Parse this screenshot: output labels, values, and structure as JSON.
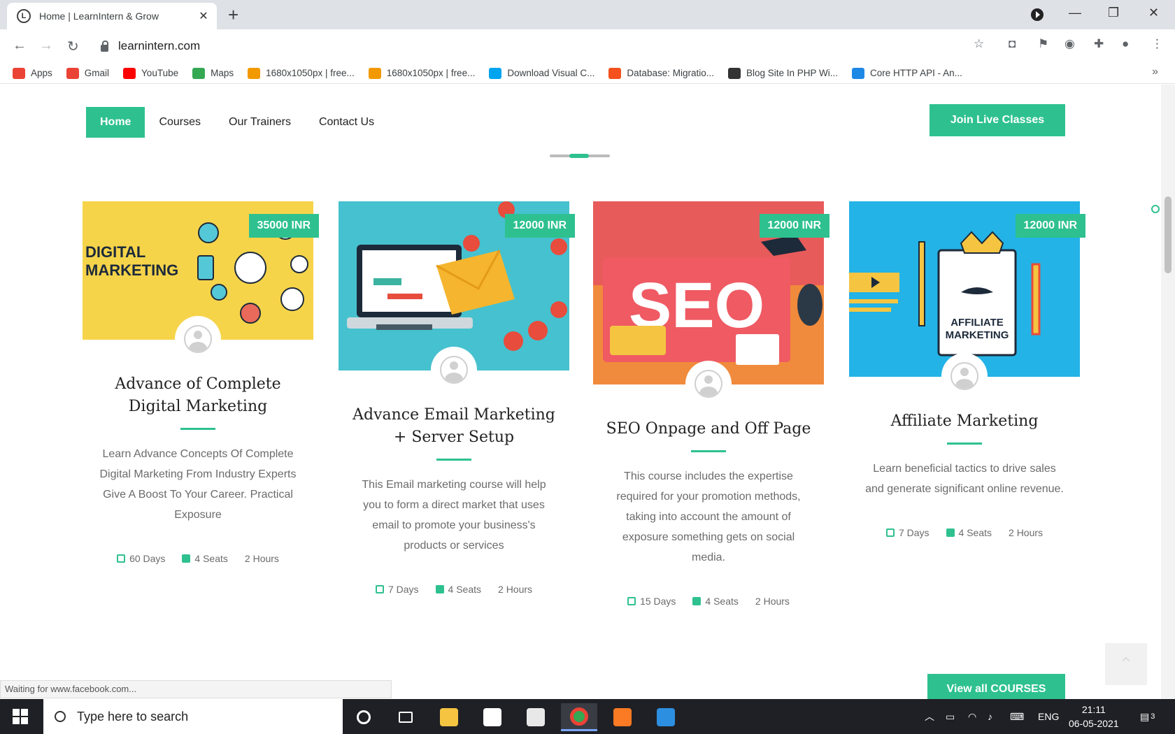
{
  "browser": {
    "tab_title": "Home | LearnIntern & Grow",
    "favicon_letter": "L",
    "url": "learnintern.com",
    "status_text": "Waiting for www.facebook.com..."
  },
  "bookmarks": [
    {
      "label": "Apps",
      "color": "#ea4335"
    },
    {
      "label": "Gmail",
      "color": "#ea4335"
    },
    {
      "label": "YouTube",
      "color": "#ff0000"
    },
    {
      "label": "Maps",
      "color": "#34a853"
    },
    {
      "label": "1680x1050px | free...",
      "color": "#f29900"
    },
    {
      "label": "1680x1050px | free...",
      "color": "#f29900"
    },
    {
      "label": "Download Visual C...",
      "color": "#00a4ef"
    },
    {
      "label": "Database: Migratio...",
      "color": "#f4511e"
    },
    {
      "label": "Blog Site In PHP Wi...",
      "color": "#333333"
    },
    {
      "label": "Core HTTP API - An...",
      "color": "#1e88e5"
    }
  ],
  "nav": {
    "items": [
      "Home",
      "Courses",
      "Our Trainers",
      "Contact Us"
    ],
    "join_label": "Join Live Classes"
  },
  "courses": [
    {
      "price": "35000 INR",
      "title": "Advance of Complete Digital Marketing",
      "desc": "Learn Advance Concepts Of Complete Digital Marketing From Industry Experts Give A Boost To Your Career. Practical Exposure",
      "days": "60 Days",
      "seats": "4 Seats",
      "hours": "2 Hours",
      "image_text": [
        "DIGITAL",
        "MARKETING"
      ],
      "image_bg": "#f6d44a"
    },
    {
      "price": "12000 INR",
      "title": "Advance Email Marketing + Server Setup",
      "desc": "This Email marketing course will help you to form a direct market that uses email to promote your business's products or services",
      "days": "7 Days",
      "seats": "4 Seats",
      "hours": "2 Hours",
      "image_bg": "#46c1cf"
    },
    {
      "price": "12000 INR",
      "title": "SEO Onpage and Off Page",
      "desc": "This course includes the expertise required for your promotion methods, taking into account the amount of exposure something gets on social media.",
      "days": "15 Days",
      "seats": "4 Seats",
      "hours": "2 Hours",
      "image_text": [
        "SEO"
      ],
      "image_bg": "#f08a3c"
    },
    {
      "price": "12000 INR",
      "title": "Affiliate Marketing",
      "desc": "Learn beneficial tactics to drive sales and generate significant online revenue.",
      "days": "7 Days",
      "seats": "4 Seats",
      "hours": "2 Hours",
      "image_text": [
        "AFFILIATE",
        "MARKETING"
      ],
      "image_bg": "#23b3e6"
    }
  ],
  "view_all_label": "View all COURSES",
  "taskbar": {
    "search_placeholder": "Type here to search",
    "lang": "ENG",
    "time": "21:11",
    "date": "06-05-2021",
    "notifications": "3"
  },
  "colors": {
    "accent": "#2ec18f"
  }
}
